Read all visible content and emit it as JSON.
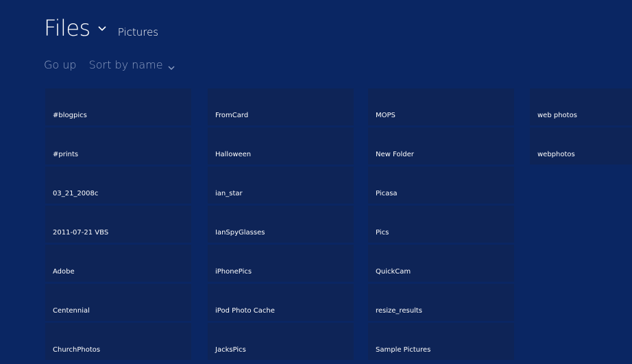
{
  "header": {
    "title": "Files",
    "location": "Pictures"
  },
  "toolbar": {
    "go_up": "Go up",
    "sort_label": "Sort by name"
  },
  "colors": {
    "background": "#0a2663",
    "tile": "#0e2457",
    "toolbar_text": "#8fa0c4"
  },
  "columns": [
    [
      "#blogpics",
      "#prints",
      "03_21_2008c",
      "2011-07-21 VBS",
      "Adobe",
      "Centennial",
      "ChurchPhotos"
    ],
    [
      "FromCard",
      "Halloween",
      "ian_star",
      "IanSpyGlasses",
      "iPhonePics",
      "iPod Photo Cache",
      "JacksPics"
    ],
    [
      "MOPS",
      "New Folder",
      "Picasa",
      "Pics",
      "QuickCam",
      "resize_results",
      "Sample Pictures"
    ],
    [
      "web photos",
      "webphotos"
    ]
  ]
}
